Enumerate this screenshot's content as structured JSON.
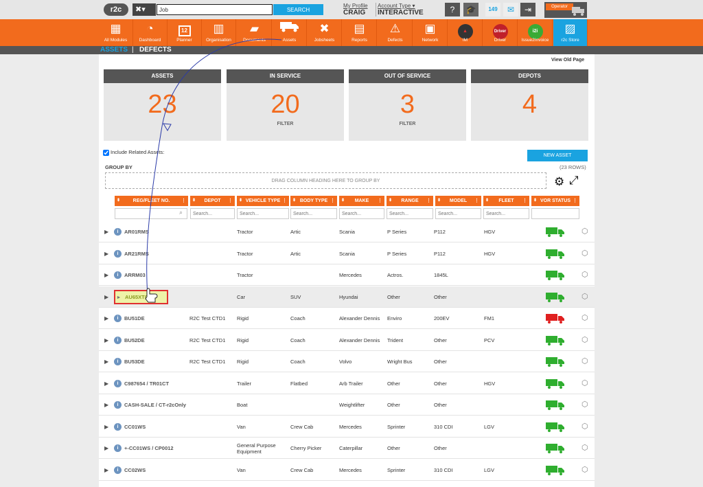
{
  "topbar": {
    "logo": "r2c",
    "tools_icon": "✖▾",
    "search_value": "Job",
    "search_label": "SEARCH",
    "profile_link": "My Profile",
    "profile_name": "CRAIG",
    "account_link": "Account Type ▾",
    "account_value": "INTERACTIVE",
    "badge_count": "149",
    "operator_label": "Operator"
  },
  "nav": {
    "items": [
      {
        "label": "All Modules",
        "icon": "grid-icon"
      },
      {
        "label": "Dashboard",
        "icon": "speedometer-icon"
      },
      {
        "label": "Planner",
        "icon": "calendar-icon"
      },
      {
        "label": "Organisation",
        "icon": "building-icon"
      },
      {
        "label": "Documents",
        "icon": "folder-icon"
      },
      {
        "label": "Assets",
        "icon": "truck-icon"
      },
      {
        "label": "Jobsheets",
        "icon": "tools-icon"
      },
      {
        "label": "Reports",
        "icon": "clipboard-icon"
      },
      {
        "label": "Defects",
        "icon": "warning-icon"
      },
      {
        "label": "Network",
        "icon": "contacts-icon"
      },
      {
        "label": "IM",
        "icon": "im-icon"
      },
      {
        "label": "Driver",
        "icon": "driver-icon"
      },
      {
        "label": "Issue2Invoice",
        "icon": "i2i-icon"
      },
      {
        "label": "r2c Store",
        "icon": "store-icon"
      }
    ],
    "calendar_day": "12",
    "driver_text": "Driver",
    "i2i_text": "i2i"
  },
  "subnav": {
    "assets": "ASSETS",
    "sep": "|",
    "defects": "DEFECTS"
  },
  "view_old": "View Old Page",
  "cards": [
    {
      "title": "ASSETS",
      "value": "23",
      "footer": ""
    },
    {
      "title": "IN SERVICE",
      "value": "20",
      "footer": "FILTER"
    },
    {
      "title": "OUT OF SERVICE",
      "value": "3",
      "footer": "FILTER"
    },
    {
      "title": "DEPOTS",
      "value": "4",
      "footer": ""
    }
  ],
  "include_related": "Include Related Assets:",
  "new_asset": "NEW ASSET",
  "group_by": "GROUP BY",
  "row_count": "(23 ROWS)",
  "group_drop": "DRAG COLUMN HEADING HERE TO GROUP BY",
  "columns": [
    "REG/FLEET NO.",
    "DEPOT",
    "VEHICLE TYPE",
    "BODY TYPE",
    "MAKE",
    "RANGE",
    "MODEL",
    "FLEET",
    "VOR STATUS"
  ],
  "filter_placeholder": "Search...",
  "rows": [
    {
      "reg": "AR01RMS",
      "depot": "",
      "vt": "Tractor",
      "bt": "Artic",
      "mk": "Scania",
      "rg": "P Series",
      "md": "P112",
      "fl": "HGV",
      "vor": "green"
    },
    {
      "reg": "AR21RMS",
      "depot": "",
      "vt": "Tractor",
      "bt": "Artic",
      "mk": "Scania",
      "rg": "P Series",
      "md": "P112",
      "fl": "HGV",
      "vor": "green"
    },
    {
      "reg": "ARRM03",
      "depot": "",
      "vt": "Tractor",
      "bt": "",
      "mk": "Mercedes",
      "rg": "Actros.",
      "md": "1845L",
      "fl": "",
      "vor": "green"
    },
    {
      "reg": "AU65XTC",
      "depot": "",
      "vt": "Car",
      "bt": "SUV",
      "mk": "Hyundai",
      "rg": "Other",
      "md": "Other",
      "fl": "",
      "vor": "green"
    },
    {
      "reg": "BU51DE",
      "depot": "R2C Test CTD1",
      "vt": "Rigid",
      "bt": "Coach",
      "mk": "Alexander Dennis",
      "rg": "Enviro",
      "md": "200EV",
      "fl": "FM1",
      "vor": "red"
    },
    {
      "reg": "BU52DE",
      "depot": "R2C Test CTD1",
      "vt": "Rigid",
      "bt": "Coach",
      "mk": "Alexander Dennis",
      "rg": "Trident",
      "md": "Other",
      "fl": "PCV",
      "vor": "green"
    },
    {
      "reg": "BU53DE",
      "depot": "R2C Test CTD1",
      "vt": "Rigid",
      "bt": "Coach",
      "mk": "Volvo",
      "rg": "Wright Bus",
      "md": "Other",
      "fl": "",
      "vor": "green"
    },
    {
      "reg": "C987654 / TR01CT",
      "depot": "",
      "vt": "Trailer",
      "bt": "Flatbed",
      "mk": "Arb Trailer",
      "rg": "Other",
      "md": "Other",
      "fl": "HGV",
      "vor": "green"
    },
    {
      "reg": "CASH-SALE / CT-r2cOnly",
      "depot": "",
      "vt": "Boat",
      "bt": "",
      "mk": "Weightlifter",
      "rg": "Other",
      "md": "Other",
      "fl": "",
      "vor": "green"
    },
    {
      "reg": "CC01WS",
      "depot": "",
      "vt": "Van",
      "bt": "Crew Cab",
      "mk": "Mercedes",
      "rg": "Sprinter",
      "md": "310 CDI",
      "fl": "LGV",
      "vor": "green"
    },
    {
      "reg": "+-CC01WS / CP0012",
      "depot": "",
      "vt": "General Purpose",
      "vt2": "Equipment",
      "bt": "Cherry Picker",
      "mk": "Caterpillar",
      "rg": "Other",
      "md": "Other",
      "fl": "",
      "vor": "green"
    },
    {
      "reg": "CC02WS",
      "depot": "",
      "vt": "Van",
      "bt": "Crew Cab",
      "mk": "Mercedes",
      "rg": "Sprinter",
      "md": "310 CDI",
      "fl": "LGV",
      "vor": "green"
    }
  ],
  "drag_label": "AU65XTC",
  "colors": {
    "orange": "#f26b1d",
    "blue": "#1aa3e0",
    "green": "#2fae2f",
    "red": "#e02020"
  }
}
